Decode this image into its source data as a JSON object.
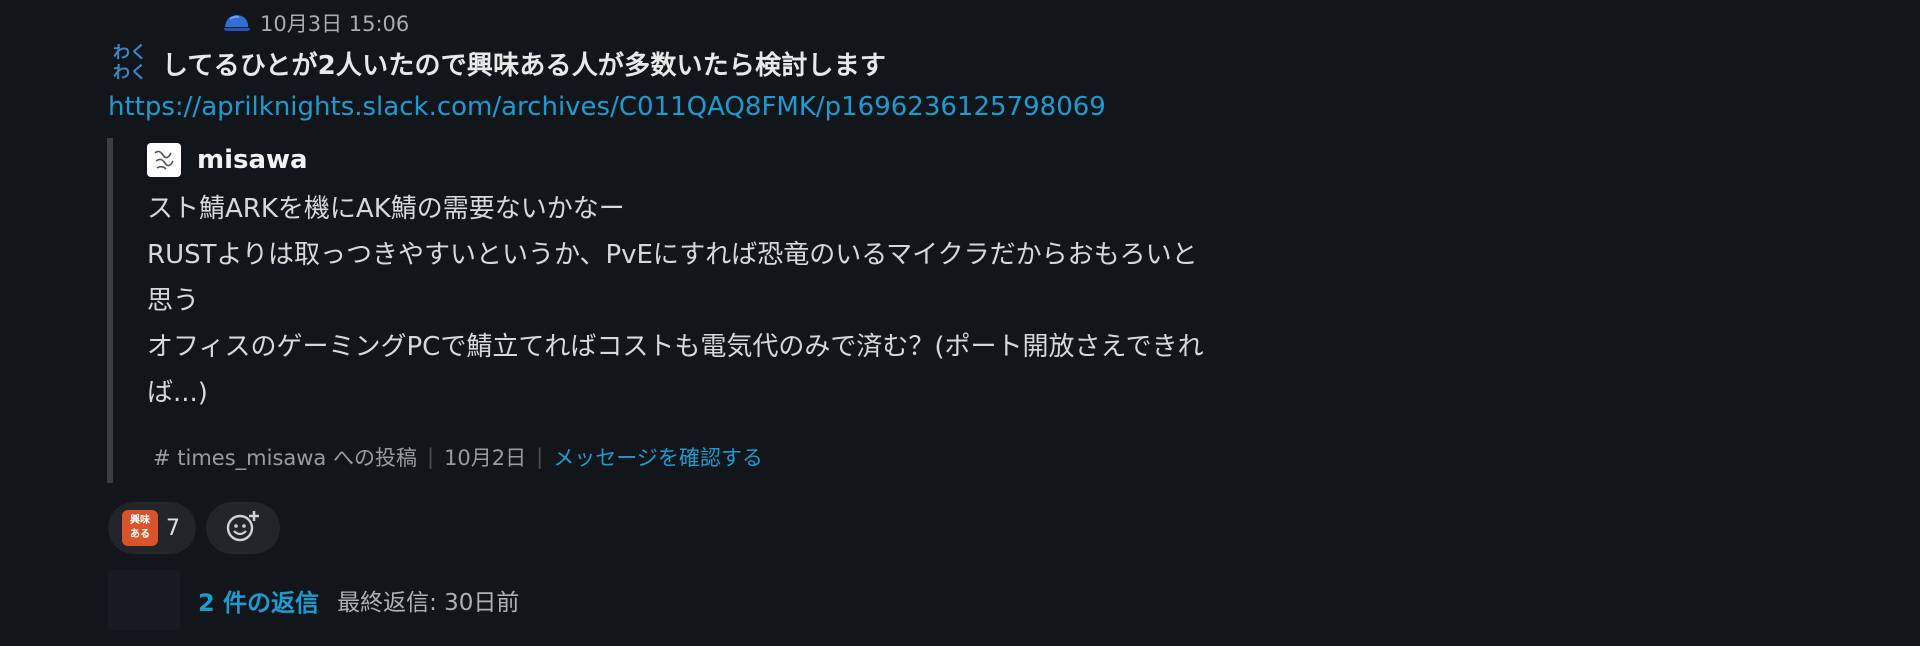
{
  "header": {
    "timestamp": "10月3日 15:06",
    "icon": "cap-icon"
  },
  "message": {
    "emoji_text_line1": "わく",
    "emoji_text_line2": "わく",
    "text": "してるひとが2人いたので興味ある人が多数いたら検討します",
    "link": "https://aprilknights.slack.com/archives/C011QAQ8FMK/p1696236125798069"
  },
  "quote": {
    "author": "misawa",
    "lines": [
      "スト鯖ARKを機にAK鯖の需要ないかなー",
      "RUSTよりは取っつきやすいというか、PvEにすれば恐竜のいるマイクラだからおもろいと",
      "思う",
      "オフィスのゲーミングPCで鯖立てればコストも電気代のみで済む？(ポート開放さえできれ",
      "ば...)"
    ],
    "channel": "# times_misawa への投稿",
    "date": "10月2日",
    "cta": "メッセージを確認する"
  },
  "reactions": [
    {
      "emoji_line1": "興味",
      "emoji_line2": "ある",
      "count": "7"
    }
  ],
  "thread": {
    "replies": "2 件の返信",
    "last_reply": "最終返信: 30日前"
  },
  "colors": {
    "background": "#12161b",
    "link": "#1d9bd1",
    "reaction_bg": "#222529"
  }
}
